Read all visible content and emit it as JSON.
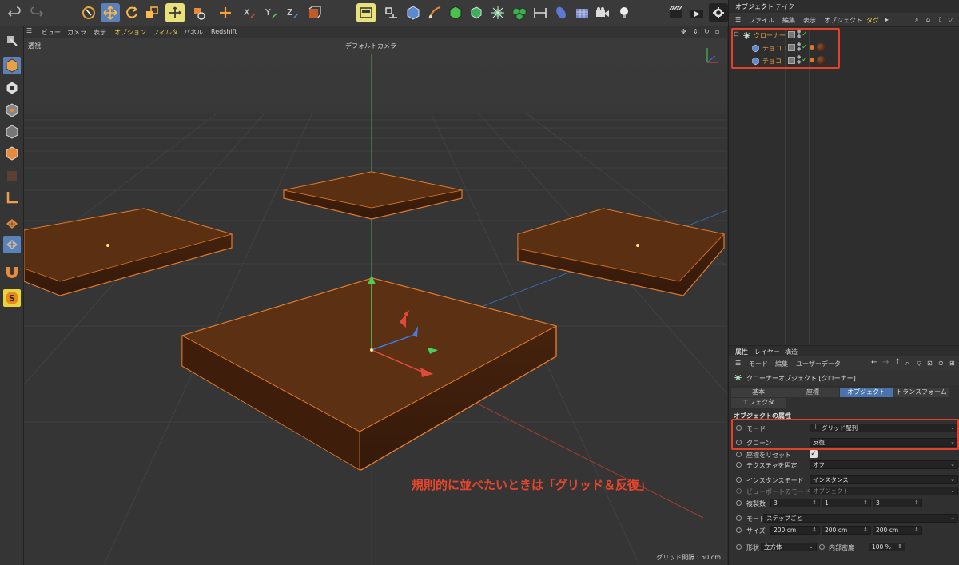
{
  "viewport": {
    "menu": [
      "ビュー",
      "カメラ",
      "表示",
      "オプション",
      "フィルタ",
      "パネル",
      "Redshift"
    ],
    "projection": "透視",
    "camera": "デフォルトカメラ",
    "grid_spacing": "グリッド間隔 : 50 cm",
    "annotation": "規則的に並べたいときは「グリッド＆反復」",
    "colors": {
      "object": "#5a2f12",
      "object_top": "#6b3817",
      "selection_outline": "#e0782a",
      "background": "#363636"
    }
  },
  "object_manager": {
    "tabs": [
      "オブジェクト",
      "テイク"
    ],
    "menu": [
      "ファイル",
      "編集",
      "表示",
      "オブジェクト",
      "タグ"
    ],
    "objects": [
      {
        "name": "クローナー",
        "icon": "cloner-icon",
        "level": 0
      },
      {
        "name": "チョコ.1",
        "icon": "cube-icon",
        "level": 1
      },
      {
        "name": "チョコ",
        "icon": "cube-icon",
        "level": 1
      }
    ]
  },
  "attribute_manager": {
    "tabs": [
      "属性",
      "レイヤー",
      "構造"
    ],
    "menu": [
      "モード",
      "編集",
      "ユーザーデータ"
    ],
    "title": "クローナーオブジェクト [クローナー]",
    "page_tabs": [
      "基本",
      "座標",
      "オブジェクト",
      "トランスフォーム",
      "エフェクタ"
    ],
    "active_page_tab": "オブジェクト",
    "section": "オブジェクトの属性",
    "props": {
      "mode": {
        "label": "モード",
        "value": "グリッド配列"
      },
      "clone": {
        "label": "クローン",
        "value": "反復"
      },
      "reset_coords": {
        "label": "座標をリセット",
        "checked": true
      },
      "fix_texture": {
        "label": "テクスチャを固定",
        "value": "オフ"
      },
      "instance_mode": {
        "label": "インスタンスモード",
        "value": "インスタンス"
      },
      "viewport_mode": {
        "label": "ビューポートのモード",
        "value": "オブジェクト"
      },
      "count": {
        "label": "複製数",
        "values": [
          "3",
          "1",
          "3"
        ]
      },
      "mode2": {
        "label": "モード",
        "value": "ステップごと"
      },
      "size": {
        "label": "サイズ",
        "values": [
          "200 cm",
          "200 cm",
          "200 cm"
        ]
      },
      "shape": {
        "label": "形状",
        "value": "立方体"
      },
      "fill": {
        "label": "内部密度",
        "value": "100 %"
      }
    }
  }
}
